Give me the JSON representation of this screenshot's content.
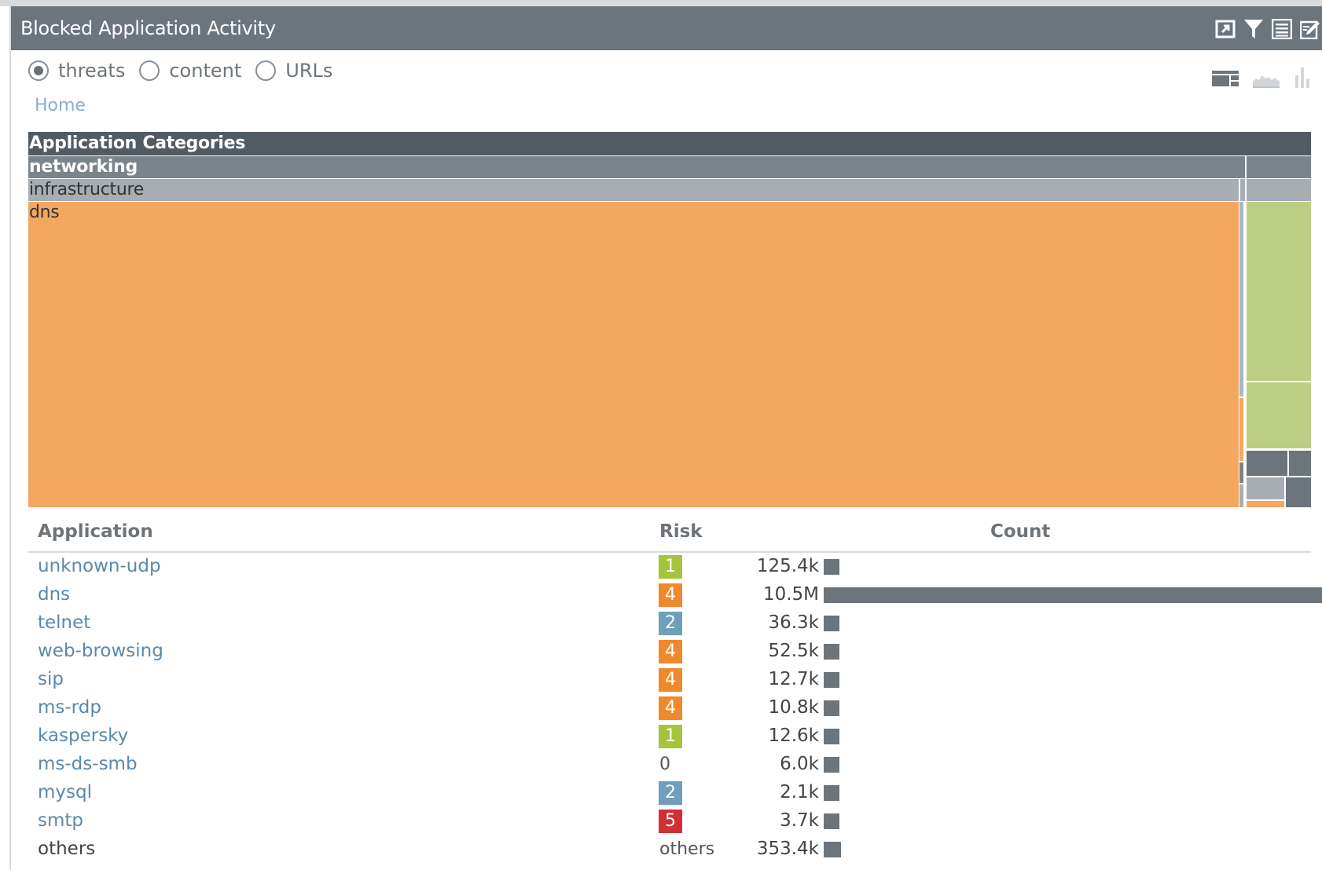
{
  "panel": {
    "title": "Blocked Application Activity",
    "title_icons": [
      "maximize-icon",
      "filter-icon",
      "list-view-icon",
      "edit-icon"
    ]
  },
  "radios": [
    {
      "label": "threats",
      "checked": true
    },
    {
      "label": "content",
      "checked": false
    },
    {
      "label": "URLs",
      "checked": false
    }
  ],
  "view_icons": [
    "treemap-view-icon",
    "area-chart-view-icon",
    "bar-chart-view-icon"
  ],
  "breadcrumb": {
    "home": "Home"
  },
  "treemap": {
    "root_label": "Application Categories",
    "level1_label": "networking",
    "level2_label": "infrastructure",
    "level3_label": "dns",
    "colors": {
      "root": "#525a62",
      "level1": "#7b838b",
      "level2": "#a7adb2",
      "dns": "#f4a761",
      "green": "#bccd84",
      "gray": "#6c747c",
      "lightgray": "#a7adb2"
    }
  },
  "table": {
    "headers": {
      "application": "Application",
      "risk": "Risk",
      "count": "Count"
    },
    "rows": [
      {
        "app": "unknown-udp",
        "risk": "1",
        "count": "125.4k",
        "value": 125400
      },
      {
        "app": "dns",
        "risk": "4",
        "count": "10.5M",
        "value": 10500000
      },
      {
        "app": "telnet",
        "risk": "2",
        "count": "36.3k",
        "value": 36300
      },
      {
        "app": "web-browsing",
        "risk": "4",
        "count": "52.5k",
        "value": 52500
      },
      {
        "app": "sip",
        "risk": "4",
        "count": "12.7k",
        "value": 12700
      },
      {
        "app": "ms-rdp",
        "risk": "4",
        "count": "10.8k",
        "value": 10800
      },
      {
        "app": "kaspersky",
        "risk": "1",
        "count": "12.6k",
        "value": 12600
      },
      {
        "app": "ms-ds-smb",
        "risk": "0",
        "count": "6.0k",
        "value": 6000
      },
      {
        "app": "mysql",
        "risk": "2",
        "count": "2.1k",
        "value": 2100
      },
      {
        "app": "smtp",
        "risk": "5",
        "count": "3.7k",
        "value": 3700
      },
      {
        "app": "others",
        "risk": "others",
        "count": "353.4k",
        "value": 353400
      }
    ],
    "risk_colors": {
      "1": "#a6c43a",
      "2": "#6f9fbb",
      "4": "#ef8a2c",
      "5": "#cf2f35"
    }
  }
}
